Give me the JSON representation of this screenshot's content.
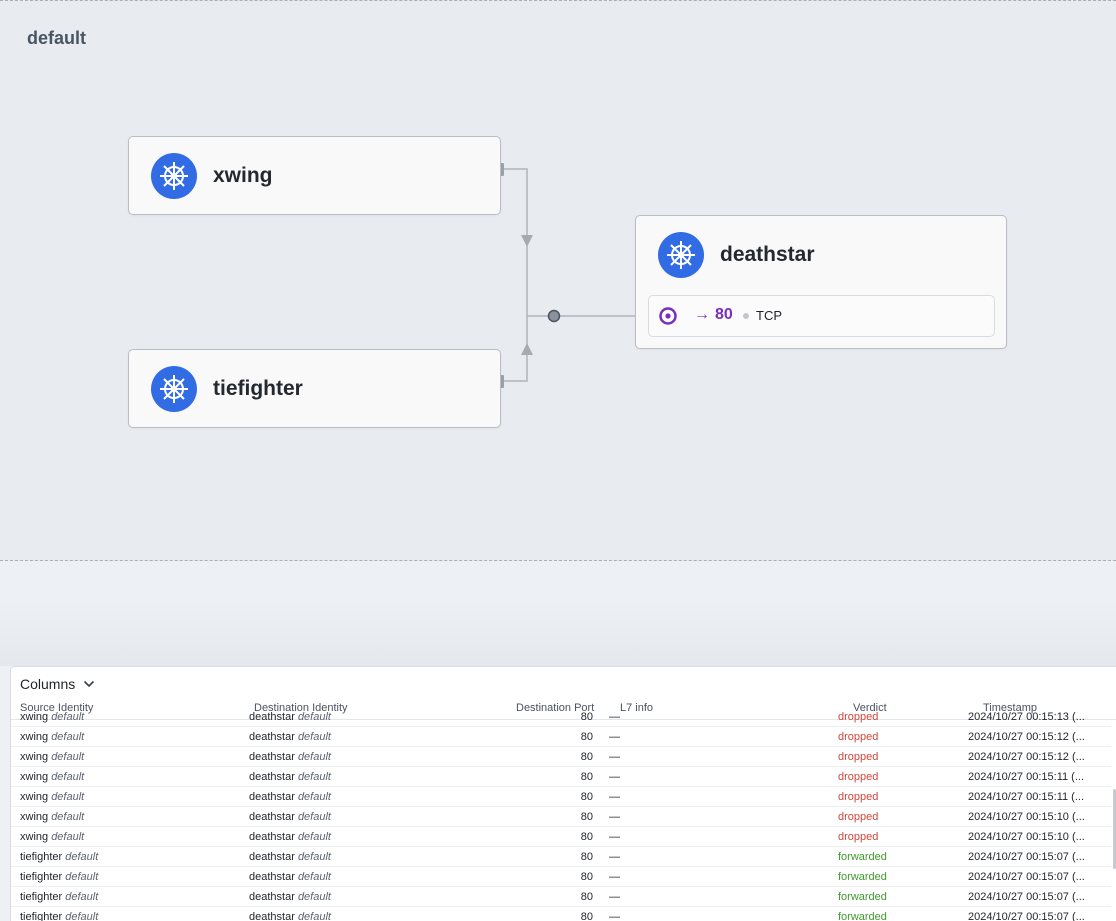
{
  "namespace": {
    "title": "default"
  },
  "services": {
    "xwing": {
      "name": "xwing",
      "icon": "kubernetes-icon"
    },
    "tiefighter": {
      "name": "tiefighter",
      "icon": "kubernetes-icon"
    },
    "deathstar": {
      "name": "deathstar",
      "icon": "kubernetes-icon",
      "port": {
        "arrow": "→",
        "number": "80",
        "protocol": "TCP"
      }
    }
  },
  "colors": {
    "kubernetes_blue": "#326ce5",
    "port_purple": "#7a2ebb",
    "dropped": "#d1453b",
    "forwarded": "#3f9a2c"
  },
  "flows_panel": {
    "columns_button": "Columns",
    "headers": {
      "source": "Source Identity",
      "destination": "Destination Identity",
      "port": "Destination Port",
      "l7": "L7 info",
      "verdict": "Verdict",
      "timestamp": "Timestamp"
    },
    "rows": [
      {
        "src": "xwing",
        "src_ns": "default",
        "dst": "deathstar",
        "dst_ns": "default",
        "port": "80",
        "l7": "—",
        "verdict": "dropped",
        "ts": "2024/10/27 00:15:13 (..."
      },
      {
        "src": "xwing",
        "src_ns": "default",
        "dst": "deathstar",
        "dst_ns": "default",
        "port": "80",
        "l7": "—",
        "verdict": "dropped",
        "ts": "2024/10/27 00:15:12 (..."
      },
      {
        "src": "xwing",
        "src_ns": "default",
        "dst": "deathstar",
        "dst_ns": "default",
        "port": "80",
        "l7": "—",
        "verdict": "dropped",
        "ts": "2024/10/27 00:15:12 (..."
      },
      {
        "src": "xwing",
        "src_ns": "default",
        "dst": "deathstar",
        "dst_ns": "default",
        "port": "80",
        "l7": "—",
        "verdict": "dropped",
        "ts": "2024/10/27 00:15:11 (..."
      },
      {
        "src": "xwing",
        "src_ns": "default",
        "dst": "deathstar",
        "dst_ns": "default",
        "port": "80",
        "l7": "—",
        "verdict": "dropped",
        "ts": "2024/10/27 00:15:11 (..."
      },
      {
        "src": "xwing",
        "src_ns": "default",
        "dst": "deathstar",
        "dst_ns": "default",
        "port": "80",
        "l7": "—",
        "verdict": "dropped",
        "ts": "2024/10/27 00:15:10 (..."
      },
      {
        "src": "xwing",
        "src_ns": "default",
        "dst": "deathstar",
        "dst_ns": "default",
        "port": "80",
        "l7": "—",
        "verdict": "dropped",
        "ts": "2024/10/27 00:15:10 (..."
      },
      {
        "src": "tiefighter",
        "src_ns": "default",
        "dst": "deathstar",
        "dst_ns": "default",
        "port": "80",
        "l7": "—",
        "verdict": "forwarded",
        "ts": "2024/10/27 00:15:07 (..."
      },
      {
        "src": "tiefighter",
        "src_ns": "default",
        "dst": "deathstar",
        "dst_ns": "default",
        "port": "80",
        "l7": "—",
        "verdict": "forwarded",
        "ts": "2024/10/27 00:15:07 (..."
      },
      {
        "src": "tiefighter",
        "src_ns": "default",
        "dst": "deathstar",
        "dst_ns": "default",
        "port": "80",
        "l7": "—",
        "verdict": "forwarded",
        "ts": "2024/10/27 00:15:07 (..."
      },
      {
        "src": "tiefighter",
        "src_ns": "default",
        "dst": "deathstar",
        "dst_ns": "default",
        "port": "80",
        "l7": "—",
        "verdict": "forwarded",
        "ts": "2024/10/27 00:15:07 (..."
      }
    ]
  }
}
